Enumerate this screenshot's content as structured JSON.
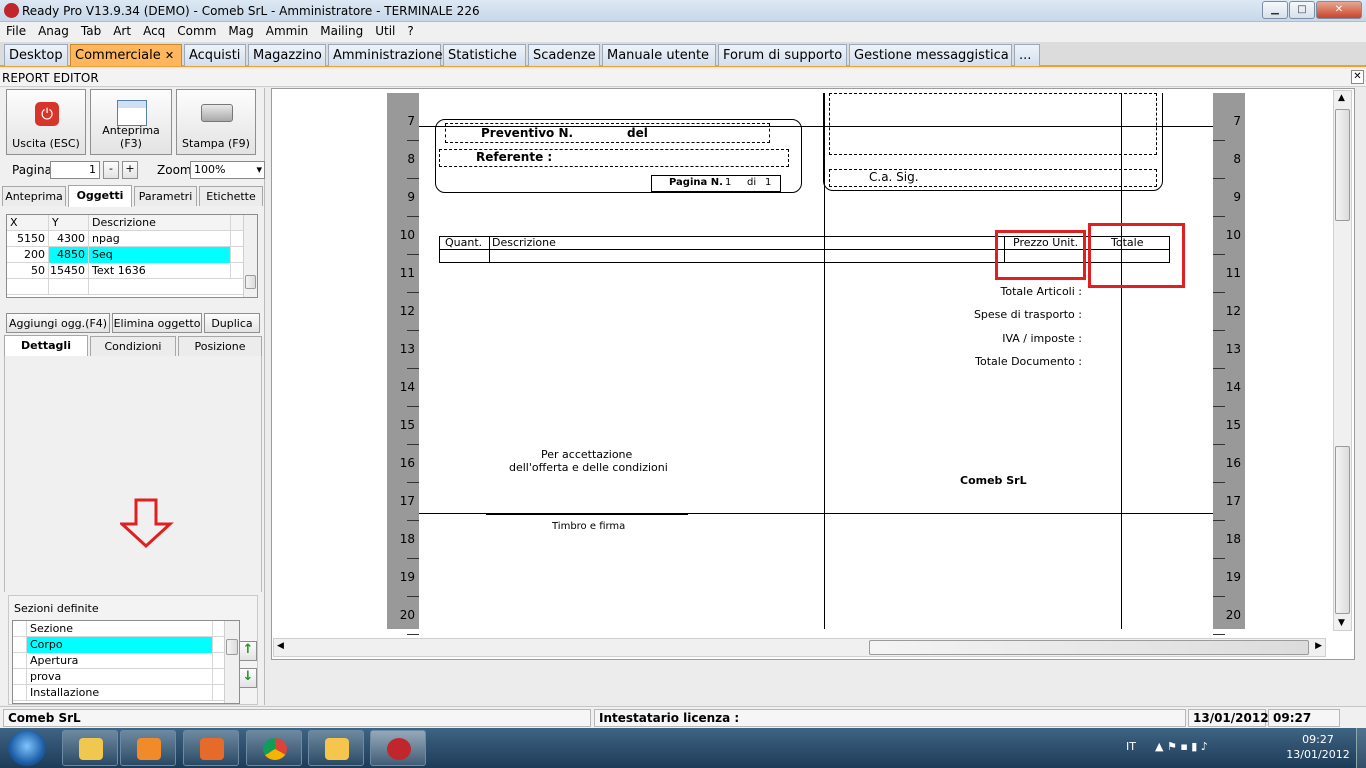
{
  "window": {
    "title": "Ready Pro V13.9.34 (DEMO)  - Comeb SrL - Amministratore - TERMINALE 226",
    "min": "▁",
    "max": "□",
    "close": "✕"
  },
  "menu": [
    "File",
    "Anag",
    "Tab",
    "Art",
    "Acq",
    "Comm",
    "Mag",
    "Ammin",
    "Mailing",
    "Util",
    "?"
  ],
  "tabs": [
    "Desktop",
    "Commerciale",
    "Acquisti",
    "Magazzino",
    "Amministrazione",
    "Statistiche",
    "Scadenze",
    "Manuale utente",
    "Forum di supporto",
    "Gestione messaggistica",
    "..."
  ],
  "tab_close": "✕",
  "report_editor": {
    "title": "REPORT EDITOR",
    "close": "✕"
  },
  "toolbar": {
    "exit": "Uscita (ESC)",
    "preview": "Anteprima (F3)",
    "print": "Stampa (F9)",
    "exit_icon_glyph": "⏻"
  },
  "page_ctrl": {
    "label": "Pagina",
    "value": "1",
    "minus": "-",
    "plus": "+",
    "zoom_label": "Zoom",
    "zoom_value": "100%",
    "dropdown": "▾"
  },
  "tabs_top": [
    "Anteprima",
    "Oggetti",
    "Parametri",
    "Etichette"
  ],
  "objects_table": {
    "headers": [
      "X",
      "Y",
      "Descrizione"
    ],
    "rows": [
      {
        "x": "5150",
        "y": "4300",
        "d": "npag"
      },
      {
        "x": "200",
        "y": "4850",
        "d": "Seq"
      },
      {
        "x": "50",
        "y": "15450",
        "d": "Text 1636"
      }
    ]
  },
  "object_buttons": [
    "Aggiungi ogg.(F4)",
    "Elimina oggetto",
    "Duplica"
  ],
  "tabs_bottom": [
    "Dettagli",
    "Condizioni",
    "Posizione"
  ],
  "sections": {
    "label": "Sezioni definite",
    "header": "Sezione",
    "items": [
      "Corpo",
      "Apertura",
      "prova",
      "Installazione"
    ],
    "up": "↑",
    "down": "↓"
  },
  "ruler": {
    "numbers": [
      "7",
      "8",
      "9",
      "10",
      "11",
      "12",
      "13",
      "14",
      "15",
      "16",
      "17",
      "18",
      "19",
      "20"
    ]
  },
  "report": {
    "preventivo": "Preventivo N.",
    "del": "del",
    "referente": "Referente :",
    "pagina": "Pagina N.",
    "pag_num": "1",
    "di": "di",
    "pag_tot": "1",
    "ca_sig": "C.a. Sig.",
    "col_quant": "Quant.",
    "col_desc": "Descrizione",
    "col_prezzo": "Prezzo Unit.",
    "col_totale": "Totale",
    "tot_articoli": "Totale Articoli :",
    "spese": "Spese di trasporto :",
    "iva": "IVA / imposte :",
    "tot_doc": "Totale Documento :",
    "accett1": "Per accettazione",
    "accett2": "dell'offerta e delle condizioni",
    "company": "Comeb SrL",
    "timbro": "Timbro e firma"
  },
  "statusbar": {
    "company": "Comeb SrL",
    "licence": "Intestatario licenza :",
    "date": "13/01/2012",
    "time": "09:27"
  },
  "taskbar": {
    "lang": "IT",
    "time": "09:27",
    "date": "13/01/2012"
  },
  "colors": {
    "highlight": "#00ffff",
    "active_tab": "#ffb65c",
    "red": "#e02020"
  }
}
